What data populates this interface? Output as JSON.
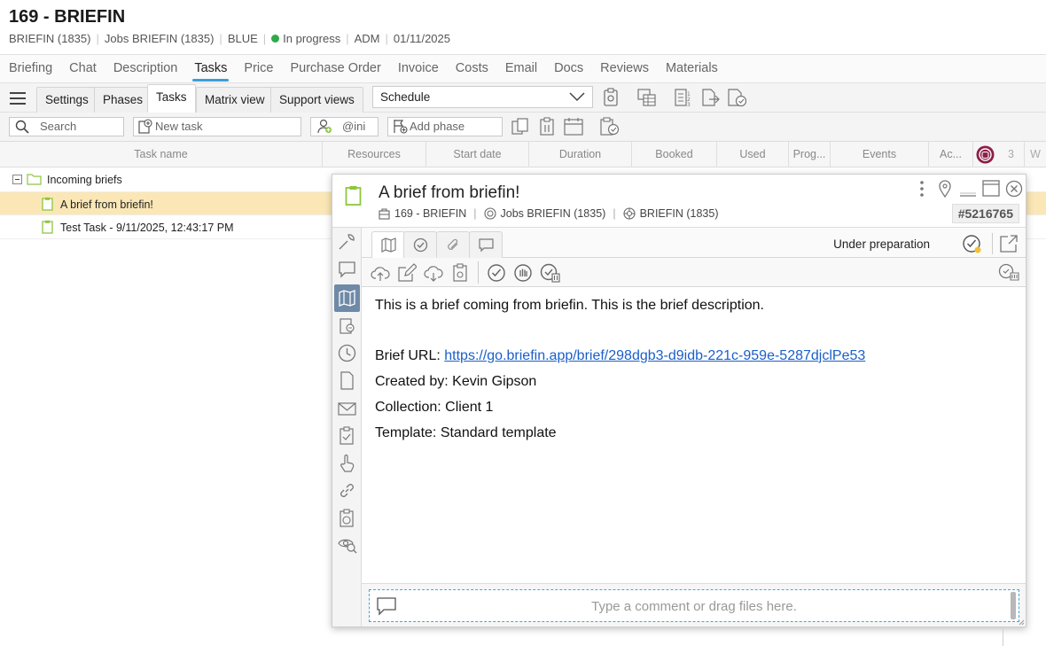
{
  "header": {
    "title": "169 - BRIEFIN",
    "meta": [
      "BRIEFIN (1835)",
      "Jobs BRIEFIN (1835)",
      "BLUE"
    ],
    "status": "In progress",
    "meta2": [
      "ADM",
      "01/11/2025"
    ],
    "status_color": "#2eaa4a"
  },
  "tabs": [
    "Briefing",
    "Chat",
    "Description",
    "Tasks",
    "Price",
    "Purchase Order",
    "Invoice",
    "Costs",
    "Email",
    "Docs",
    "Reviews",
    "Materials"
  ],
  "active_tab": "Tasks",
  "subtabs": {
    "settings": "Settings",
    "phases": "Phases",
    "tasks": "Tasks",
    "matrix": "Matrix view",
    "support": "Support views"
  },
  "schedule_select": "Schedule",
  "toolbar": {
    "search_placeholder": "Search",
    "new_task_placeholder": "New task",
    "user_filter": "@ini",
    "add_phase": "Add phase"
  },
  "columns": {
    "task_name": "Task name",
    "resources": "Resources",
    "start_date": "Start date",
    "duration": "Duration",
    "booked": "Booked",
    "used": "Used",
    "progress": "Prog...",
    "events": "Events",
    "ac": "Ac...",
    "num": "3",
    "w": "W"
  },
  "rows": {
    "group": "Incoming briefs",
    "task1": "A brief from briefin!",
    "task2": "Test Task - 9/11/2025, 12:43:17 PM"
  },
  "panel": {
    "title": "A brief from briefin!",
    "job": "169 - BRIEFIN",
    "jobs": "Jobs BRIEFIN (1835)",
    "client": "BRIEFIN (1835)",
    "id": "#5216765",
    "status": "Under preparation",
    "body": {
      "line1": "This is a brief coming from briefin. This is the brief description.",
      "url_label": "Brief URL: ",
      "url": "https://go.briefin.app/brief/298dgb3-d9idb-221c-959e-5287djclPe53",
      "created": "Created by: Kevin Gipson",
      "collection": "Collection: Client 1",
      "template": "Template: Standard template"
    },
    "comment_placeholder": "Type a comment or drag files here."
  },
  "colors": {
    "accent": "#3d9ed9",
    "highlight": "#fbe7b6",
    "task_icon": "#8dc63f",
    "link": "#1a5fc9"
  }
}
